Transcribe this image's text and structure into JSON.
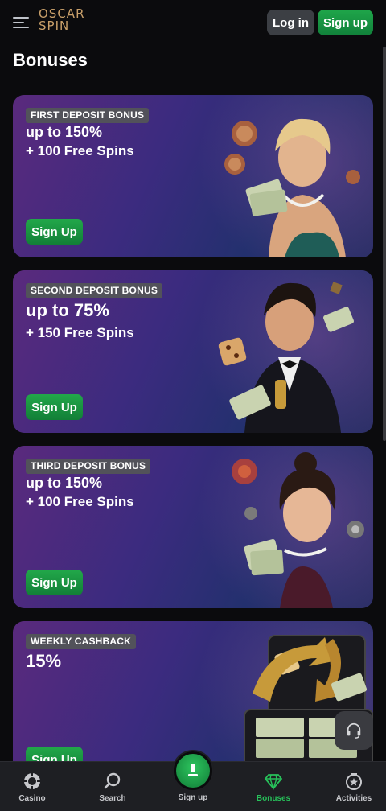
{
  "header": {
    "logo_top": "OSCAR",
    "logo_bottom": "SPIN",
    "login_label": "Log in",
    "signup_label": "Sign up"
  },
  "page_title": "Bonuses",
  "cards": [
    {
      "badge": "FIRST DEPOSIT BONUS",
      "line1": "up to 150%",
      "line2": "+ 100 Free Spins",
      "cta": "Sign Up"
    },
    {
      "badge": "SECOND DEPOSIT BONUS",
      "line1": "up to 75%",
      "line2": "+ 150 Free Spins",
      "cta": "Sign Up"
    },
    {
      "badge": "THIRD DEPOSIT BONUS",
      "line1": "up to 150%",
      "line2": "+ 100 Free Spins",
      "cta": "Sign Up"
    },
    {
      "badge": "WEEKLY CASHBACK",
      "line1": "15%",
      "line2": "",
      "cta": "Sign Up"
    }
  ],
  "bottom_nav": {
    "casino": "Casino",
    "search": "Search",
    "signup": "Sign up",
    "bonuses": "Bonuses",
    "activities": "Activities"
  },
  "icons": {
    "menu": "hamburger-icon",
    "support": "headset-icon",
    "casino": "chip-icon",
    "search": "search-icon",
    "signup": "microphone-icon",
    "bonuses": "diamond-icon",
    "activities": "star-badge-icon"
  },
  "colors": {
    "accent_green": "#1fa64a",
    "active_nav": "#27c15a",
    "logo_gold": "#c9a06a"
  }
}
